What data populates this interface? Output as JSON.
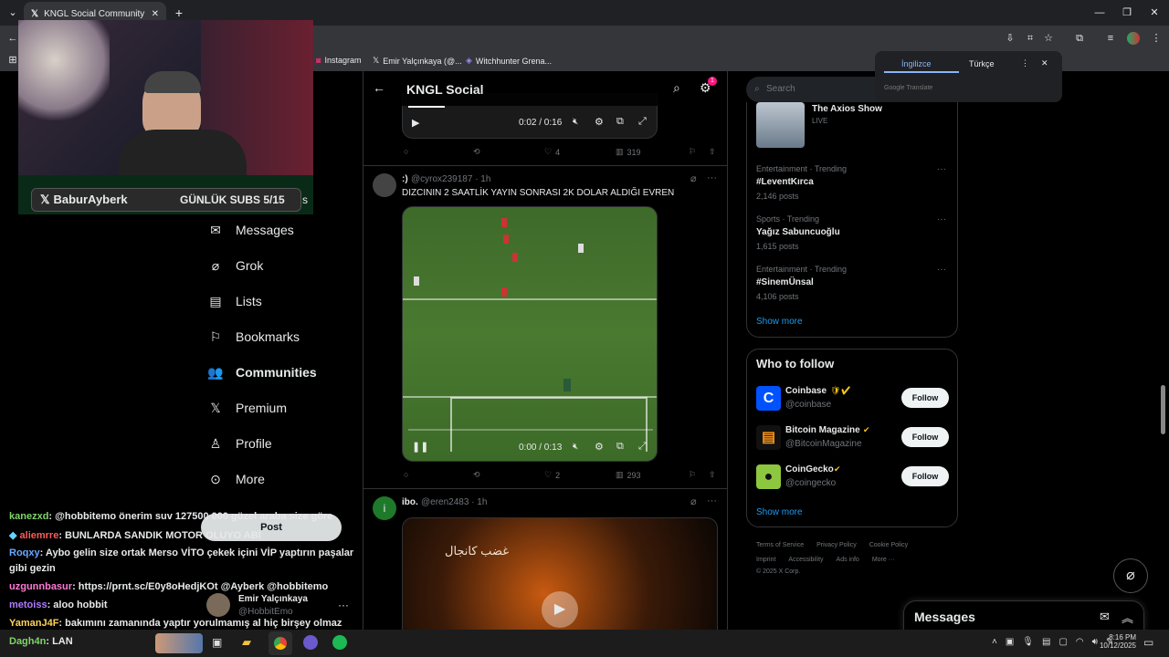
{
  "browser": {
    "tab_title": "KNGL Social Community / X",
    "bookmarks": [
      "Instagram",
      "Emir Yalçınkaya (@...",
      "Witchhunter Grena..."
    ]
  },
  "translate": {
    "lang1": "İngilizce",
    "lang2": "Türkçe",
    "brand": "Google Translate"
  },
  "stream": {
    "name": "BaburAyberk",
    "subs": "GÜNLÜK SUBS 5/15",
    "subs_tail": "s"
  },
  "nav": {
    "items": [
      "Messages",
      "Grok",
      "Lists",
      "Bookmarks",
      "Communities",
      "Premium",
      "Profile",
      "More"
    ],
    "post": "Post"
  },
  "account": {
    "name": "Emir Yalçınkaya",
    "handle": "@HobbitEmo"
  },
  "header": {
    "title": "KNGL Social",
    "badge": "1"
  },
  "tweet0": {
    "time": "0:02 / 0:16",
    "replies": "",
    "retweets": "",
    "likes": "4",
    "views": "319"
  },
  "tweet1": {
    "name": ":)",
    "handle": "@cyrox239187 · 1h",
    "text": "DIZCININ 2 SAATLİK YAYIN SONRASI 2K DOLAR ALDIĞI EVREN",
    "time": "0:00 / 0:13",
    "likes": "2",
    "views": "293"
  },
  "tweet2": {
    "avatar_letter": "i",
    "name": "ibo.",
    "handle": "@eren2483 · 1h",
    "thumb_text": "غضب كانجال"
  },
  "search": {
    "placeholder": "Search"
  },
  "axios": {
    "title": "The Axios Show",
    "live": "LIVE"
  },
  "trends": [
    {
      "cat": "Entertainment · Trending",
      "tag": "#LeventKırca",
      "count": "2,146 posts"
    },
    {
      "cat": "Sports · Trending",
      "tag": "Yağız Sabuncuoğlu",
      "count": "1,615 posts"
    },
    {
      "cat": "Entertainment · Trending",
      "tag": "#SinemÜnsal",
      "count": "4,106 posts"
    }
  ],
  "show_more": "Show more",
  "who": {
    "title": "Who to follow",
    "follow": "Follow",
    "show_more": "Show more",
    "accounts": [
      {
        "name": "Coinbase",
        "handle": "@coinbase"
      },
      {
        "name": "Bitcoin Magazine",
        "handle": "@BitcoinMagazine"
      },
      {
        "name": "CoinGecko",
        "handle": "@coingecko"
      }
    ]
  },
  "footer": {
    "line1": [
      "Terms of Service",
      "Privacy Policy",
      "Cookie Policy"
    ],
    "line2": [
      "Imprint",
      "Accessibility",
      "Ads info",
      "More ···"
    ],
    "copy": "© 2025 X Corp."
  },
  "messages": {
    "title": "Messages"
  },
  "chat": [
    {
      "user": "kanezxd",
      "color": "#7fd46a",
      "msg": ": @hobbitemo önerim suv 127500 000 güzel araba size göre"
    },
    {
      "user": "aliemrre",
      "color": "#ff5a5a",
      "msg": ": BUNLARDA SANDIK MOTOR OLUYO ABİ"
    },
    {
      "user": "Roqxy",
      "color": "#6aa8ff",
      "msg": ": Aybo gelin size ortak Merso VİTO çekek içini VİP yaptırın paşalar"
    },
    {
      "user": "",
      "color": "#fff",
      "msg": "gibi gezin"
    },
    {
      "user": "uzgunnbasur",
      "color": "#ff7ad6",
      "msg": ": https://prnt.sc/E0y8oHedjKOt @Ayberk @hobbitemo"
    },
    {
      "user": "metoiss",
      "color": "#b07aff",
      "msg": ": aloo hobbit"
    },
    {
      "user": "YamanJ4F",
      "color": "#ffd35a",
      "msg": ": bakımını zamanında yaptır yorulmamış al hiç birşey olmaz"
    },
    {
      "user": "Dagh4n",
      "color": "#7fd46a",
      "msg": ": LAN"
    }
  ],
  "taskbar": {
    "time": "8:16 PM",
    "date": "10/12/2025"
  }
}
